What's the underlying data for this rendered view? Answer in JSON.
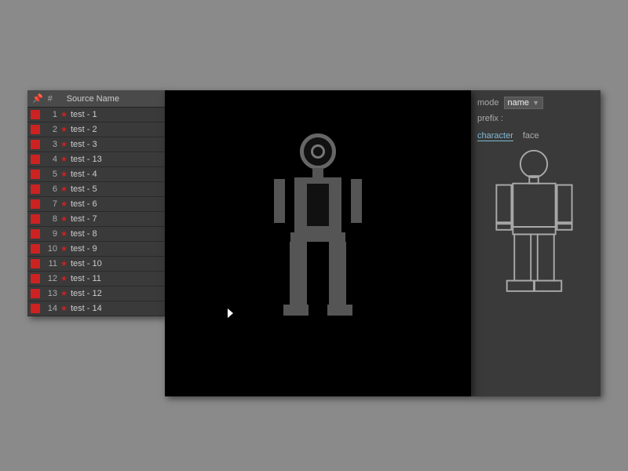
{
  "left_panel": {
    "header": {
      "icon": "📌",
      "hash": "#",
      "source_name": "Source Name"
    },
    "items": [
      {
        "number": "1",
        "name": "test - 1"
      },
      {
        "number": "2",
        "name": "test - 2"
      },
      {
        "number": "3",
        "name": "test - 3"
      },
      {
        "number": "4",
        "name": "test - 13"
      },
      {
        "number": "5",
        "name": "test - 4"
      },
      {
        "number": "6",
        "name": "test - 5"
      },
      {
        "number": "7",
        "name": "test - 6"
      },
      {
        "number": "8",
        "name": "test - 7"
      },
      {
        "number": "9",
        "name": "test - 8"
      },
      {
        "number": "10",
        "name": "test - 9"
      },
      {
        "number": "11",
        "name": "test - 10"
      },
      {
        "number": "12",
        "name": "test - 11"
      },
      {
        "number": "13",
        "name": "test - 12"
      },
      {
        "number": "14",
        "name": "test - 14"
      }
    ]
  },
  "right_panel": {
    "mode_label": "mode",
    "mode_value": "name",
    "prefix_label": "prefix :",
    "tab_character": "character",
    "tab_face": "face"
  }
}
